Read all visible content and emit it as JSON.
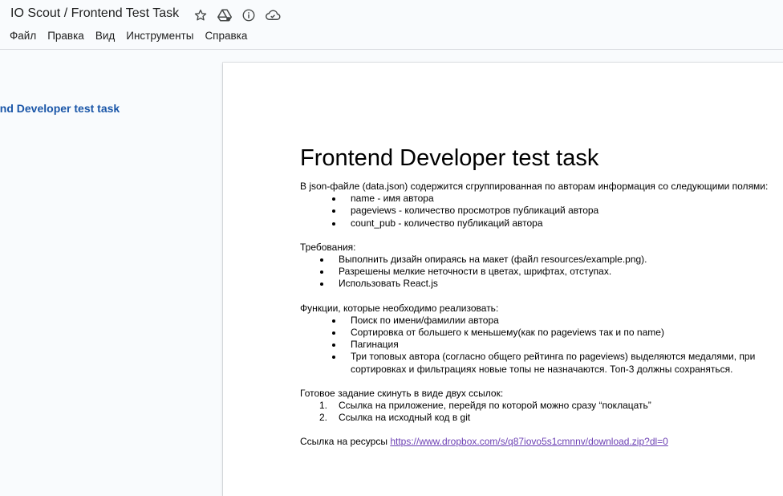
{
  "header": {
    "doc_title": "IO Scout / Frontend Test Task",
    "icons": [
      "star-icon",
      "drive-folder-icon",
      "info-icon",
      "cloud-status-icon"
    ]
  },
  "menu": [
    "Файл",
    "Правка",
    "Вид",
    "Инструменты",
    "Справка"
  ],
  "outline": {
    "title": "end Developer test task"
  },
  "document": {
    "heading": "Frontend Developer test task",
    "intro": "В json-файле (data.json) содержится сгруппированная по авторам информация со следующими полями:",
    "fields": [
      "name - имя автора",
      "pageviews - количество просмотров публикаций автора",
      "count_pub - количество публикаций автора"
    ],
    "requirements_title": "Требования:",
    "requirements": [
      "Выполнить дизайн опираясь на макет (файл resources/example.png).",
      "Разрешены мелкие неточности в цветах, шрифтах, отступах.",
      "Использовать React.js"
    ],
    "functions_title": "Функции, которые необходимо реализовать:",
    "functions": [
      "Поиск по имени/фамилии автора",
      "Сортировка от большего к меньшему(как по pageviews так и по name)",
      "Пагинация",
      "Три топовых автора (согласно общего рейтинга по pageviews) выделяются медалями, при",
      "сортировках и фильтрациях новые топы не назначаются. Топ-3 должны сохраняться."
    ],
    "submit_title": "Готовое задание скинуть в виде двух ссылок:",
    "submit_items": [
      {
        "num": "1.",
        "text": "Ссылка на приложение, перейдя по которой можно сразу “поклацать”"
      },
      {
        "num": "2.",
        "text": "Ссылка на исходный код в git"
      }
    ],
    "resources_label": "Ссылка на ресурсы",
    "resources_link": "https://www.dropbox.com/s/q87iovo5s1cmnnv/download.zip?dl=0"
  }
}
